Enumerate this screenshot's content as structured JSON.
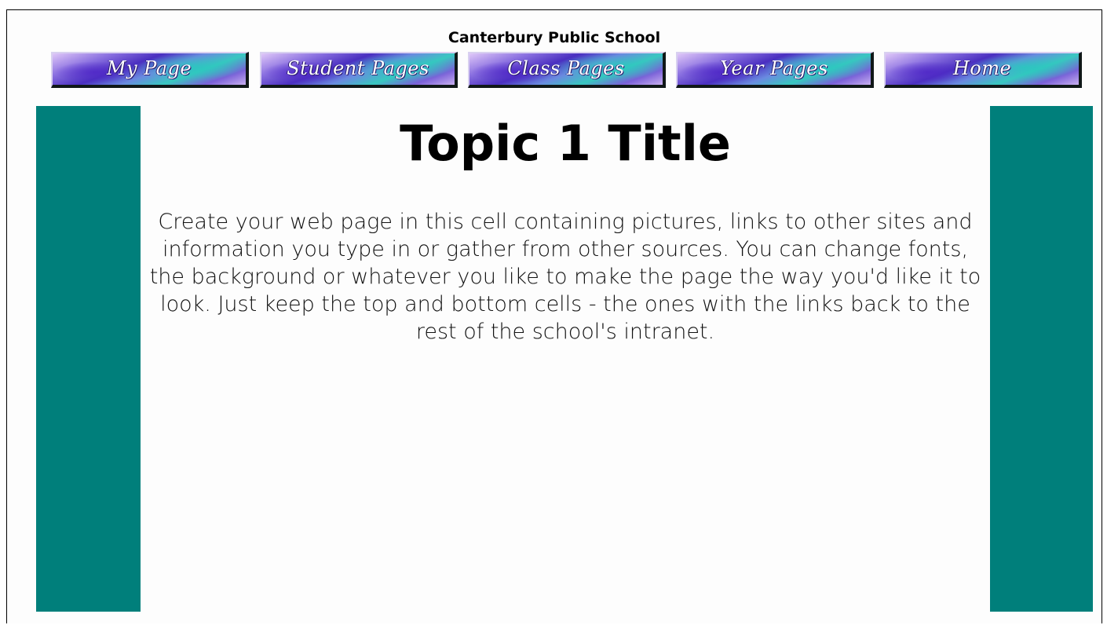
{
  "header": {
    "school_name": "Canterbury Public School"
  },
  "nav": {
    "items": [
      {
        "label": "My Page"
      },
      {
        "label": "Student Pages"
      },
      {
        "label": "Class Pages"
      },
      {
        "label": "Year Pages"
      },
      {
        "label": "Home"
      }
    ]
  },
  "main": {
    "title": "Topic 1 Title",
    "body": "Create your web page in this cell containing pictures, links to other sites and information you type in or gather from other sources.  You can change fonts, the background or whatever you like to make the page the way you'd like it to look.  Just keep the top and bottom cells - the ones with the links back to the rest of the school's intranet."
  },
  "colors": {
    "side_bar": "#007f7b",
    "page_background": "#fdfdfd"
  }
}
